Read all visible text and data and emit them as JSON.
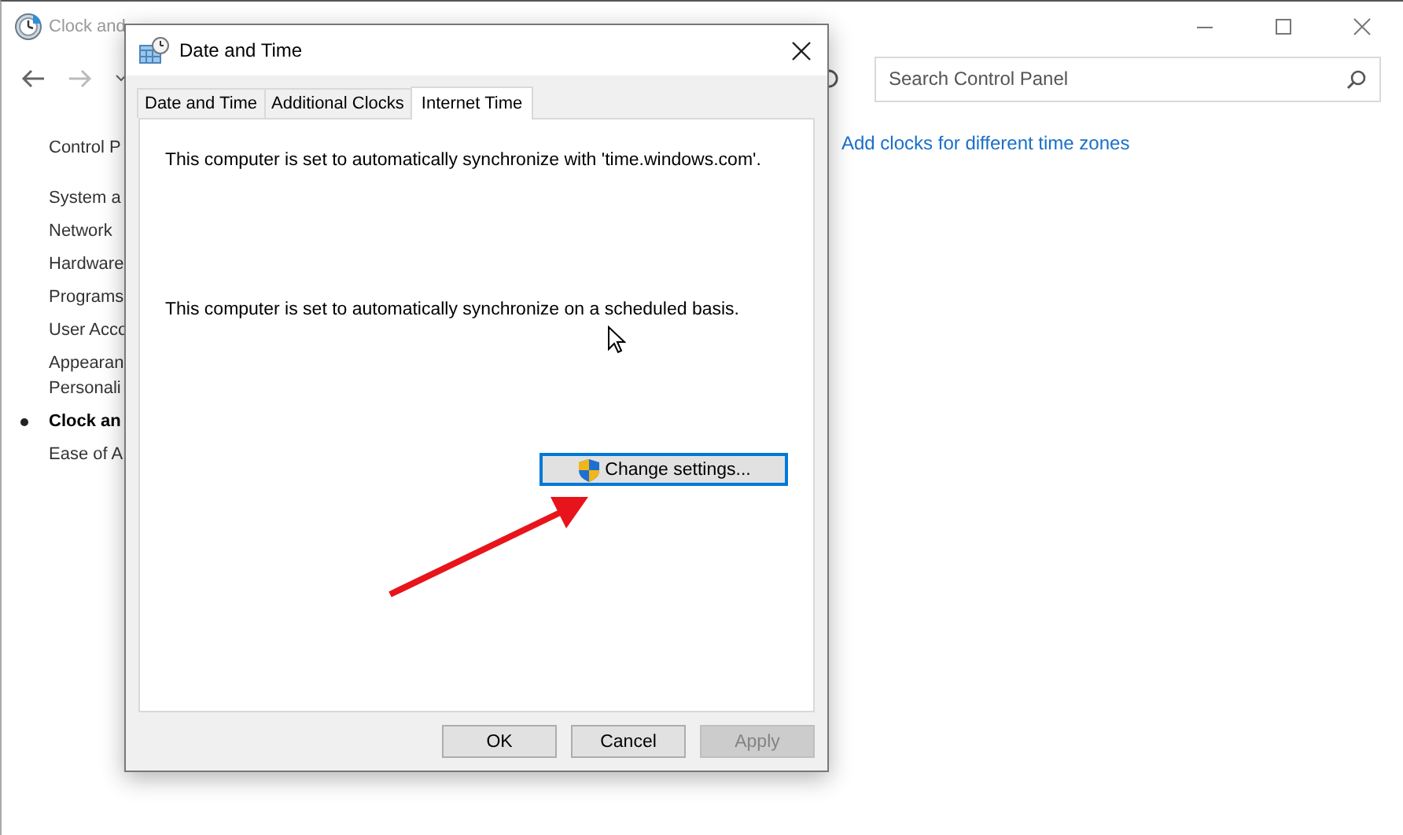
{
  "window": {
    "title": "Clock and"
  },
  "search": {
    "placeholder": "Search Control Panel"
  },
  "sidebar": {
    "items": [
      {
        "label": "Control P",
        "selected": false,
        "kind": "home"
      },
      {
        "label": "System a",
        "selected": false,
        "kind": "category"
      },
      {
        "label": "Network",
        "selected": false,
        "kind": "category"
      },
      {
        "label": "Hardware",
        "selected": false,
        "kind": "category"
      },
      {
        "label": "Programs",
        "selected": false,
        "kind": "category"
      },
      {
        "label": "User Acco",
        "selected": false,
        "kind": "category"
      },
      {
        "label": "Appearan\nPersonali",
        "selected": false,
        "kind": "category"
      },
      {
        "label": "Clock an",
        "selected": true,
        "kind": "category"
      },
      {
        "label": "Ease of A",
        "selected": false,
        "kind": "category"
      }
    ]
  },
  "content": {
    "link": "Add clocks for different time zones"
  },
  "dialog": {
    "title": "Date and Time",
    "tabs": [
      {
        "label": "Date and Time",
        "selected": false
      },
      {
        "label": "Additional Clocks",
        "selected": false
      },
      {
        "label": "Internet Time",
        "selected": true
      }
    ],
    "messages": [
      "This computer is set to automatically synchronize with 'time.windows.com'.",
      "This computer is set to automatically synchronize on a scheduled basis."
    ],
    "change_button": {
      "label": "Change settings...",
      "focused": true
    },
    "buttons": [
      {
        "label": "OK",
        "disabled": false
      },
      {
        "label": "Cancel",
        "disabled": false
      },
      {
        "label": "Apply",
        "disabled": true
      }
    ]
  }
}
